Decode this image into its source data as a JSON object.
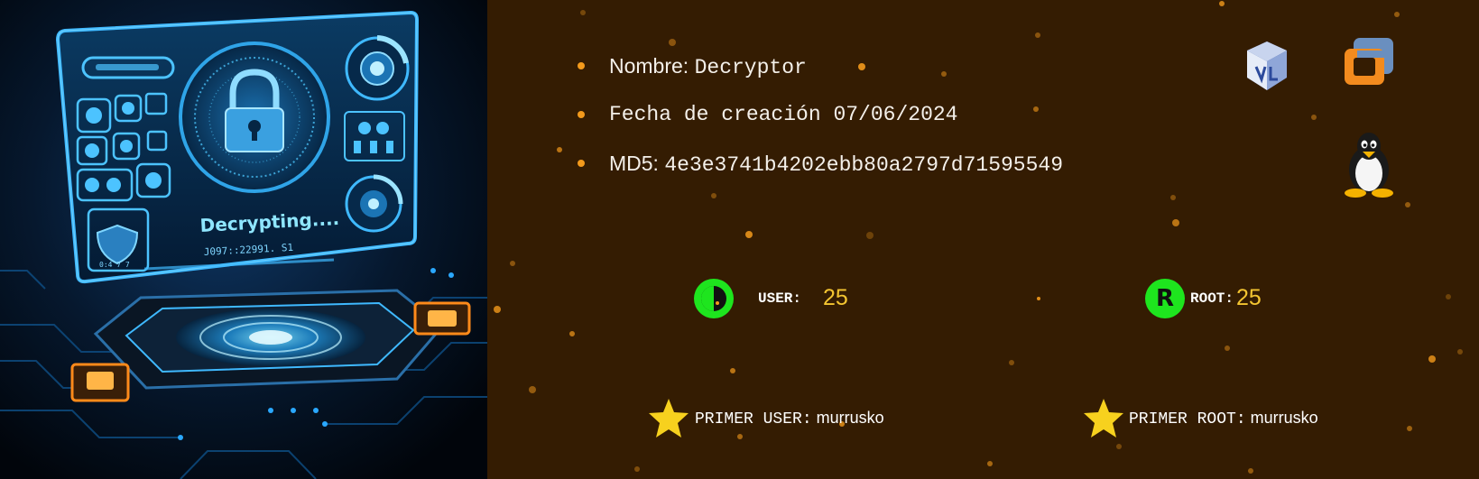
{
  "hero": {
    "screen_text": "Decrypting....",
    "screen_code": "J097::22991. S1",
    "chip_text": "0:4 7 7"
  },
  "machine": {
    "name_label": "Nombre:",
    "name_value": "Decryptor",
    "created_label": "Fecha de creación",
    "created_value": "07/06/2024",
    "md5_label": "MD5:",
    "md5_value": "4e3e3741b4202ebb80a2797d71595549"
  },
  "platforms": [
    {
      "icon": "virtualbox-icon"
    },
    {
      "icon": "vmware-icon"
    },
    {
      "icon": "linux-tux-icon"
    }
  ],
  "stats": {
    "user_label": "USER:",
    "user_value": "25",
    "root_label": "ROOT:",
    "root_value": "25",
    "root_badge": "R"
  },
  "first_bloods": {
    "user_label": "PRIMER USER:",
    "user_value": "murrusko",
    "root_label": "PRIMER ROOT:",
    "root_value": "murrusko"
  },
  "colors": {
    "background": "#341c02",
    "accent_orange": "#f39a1c",
    "status_green": "#1ee51e",
    "score_yellow": "#f4c531",
    "star_yellow": "#f7d11e"
  }
}
